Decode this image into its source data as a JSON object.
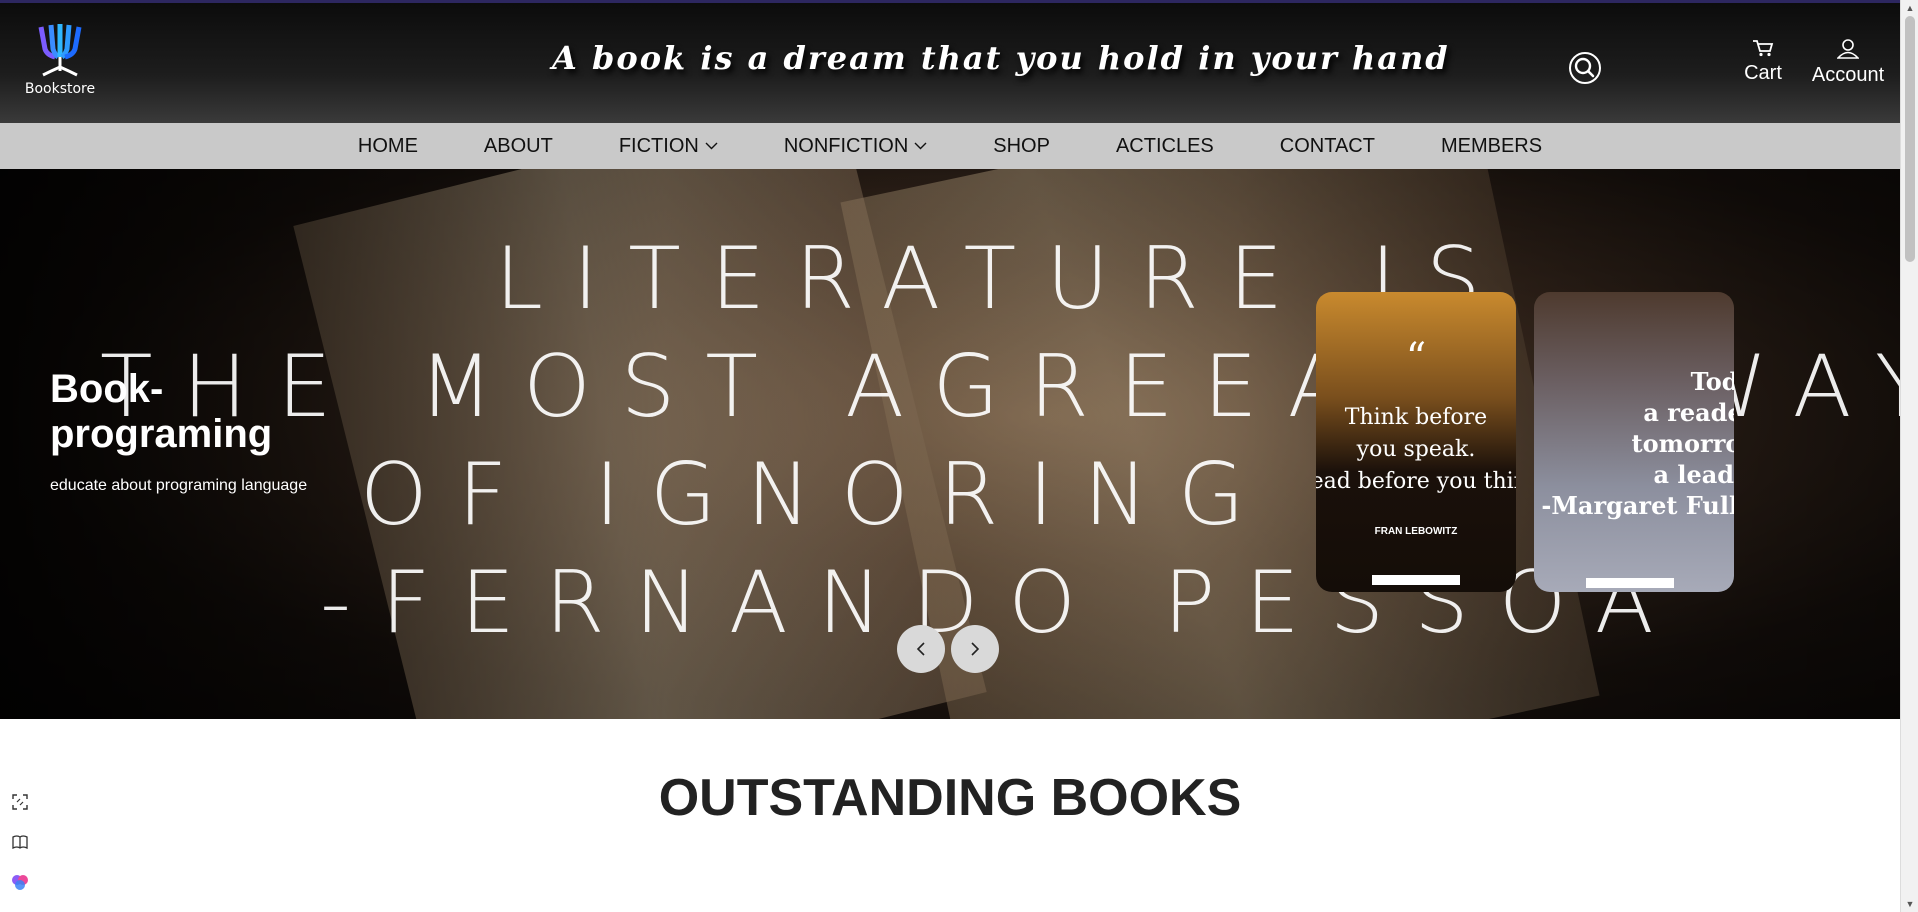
{
  "brand": {
    "logo_text": "Bookstore"
  },
  "header": {
    "tagline": "A book is a dream that you hold in your hand",
    "cart_label": "Cart",
    "account_label": "Account"
  },
  "nav": {
    "items": [
      {
        "label": "HOME",
        "dropdown": false
      },
      {
        "label": "ABOUT",
        "dropdown": false
      },
      {
        "label": "FICTION",
        "dropdown": true
      },
      {
        "label": "NONFICTION",
        "dropdown": true
      },
      {
        "label": "SHOP",
        "dropdown": false
      },
      {
        "label": "ACTICLES",
        "dropdown": false
      },
      {
        "label": "CONTACT",
        "dropdown": false
      },
      {
        "label": "MEMBERS",
        "dropdown": false
      }
    ]
  },
  "hero": {
    "quote_lines": [
      "LITERATURE IS",
      "THE MOST AGREEABLE WAY",
      "OF IGNORING LIFE",
      "-FERNANDO PESSOA"
    ],
    "slide_title": "Book-programing",
    "slide_description": "educate about programing language",
    "cards": [
      {
        "quote_lines": [
          "Think before",
          "you speak.",
          "Read before you think"
        ],
        "author": "FRAN LEBOWITZ"
      },
      {
        "quote_lines": [
          "Today",
          "a reader,",
          "tomorrow",
          "a leader",
          "-Margaret Fuller"
        ],
        "author": ""
      }
    ]
  },
  "section": {
    "title": "OUTSTANDING BOOKS"
  },
  "colors": {
    "header_bg": "#1d1d1d",
    "nav_bg": "#c9c9c9",
    "text_on_dark": "#ffffff"
  },
  "icons": [
    "search-icon",
    "cart-icon",
    "user-icon",
    "chevron-left-icon",
    "chevron-right-icon"
  ]
}
